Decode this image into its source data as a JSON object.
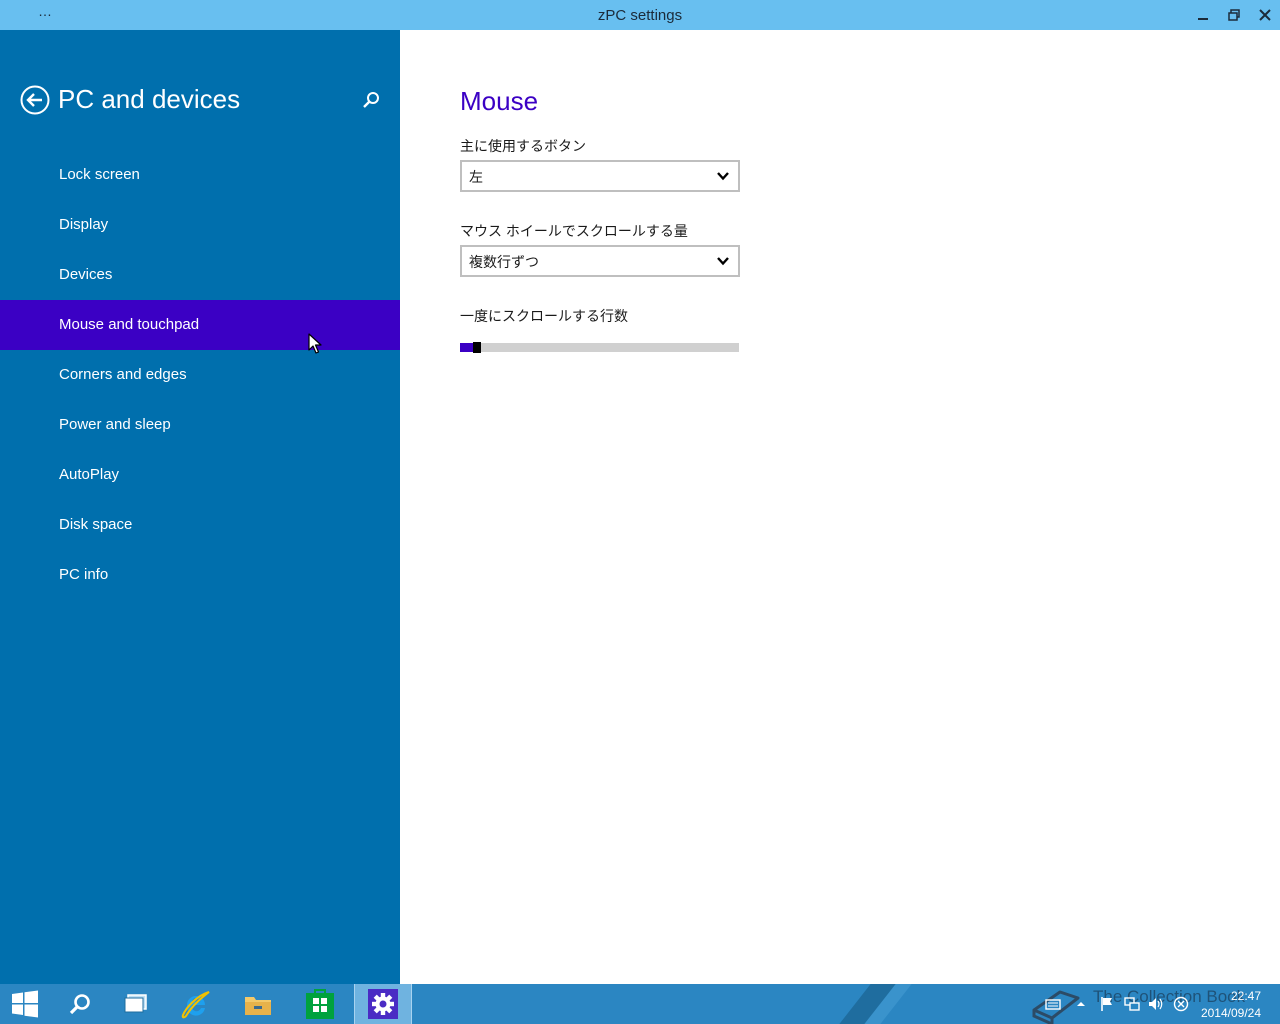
{
  "window": {
    "title": "zPC settings",
    "menu_glyph": "…",
    "controls": [
      "minimize",
      "restore",
      "close"
    ]
  },
  "sidebar": {
    "header_title": "PC and devices",
    "items": [
      {
        "label": "Lock screen",
        "active": false
      },
      {
        "label": "Display",
        "active": false
      },
      {
        "label": "Devices",
        "active": false
      },
      {
        "label": "Mouse and touchpad",
        "active": true
      },
      {
        "label": "Corners and edges",
        "active": false
      },
      {
        "label": "Power and sleep",
        "active": false
      },
      {
        "label": "AutoPlay",
        "active": false
      },
      {
        "label": "Disk space",
        "active": false
      },
      {
        "label": "PC info",
        "active": false
      }
    ]
  },
  "content": {
    "title": "Mouse",
    "primary_button": {
      "label": "主に使用するボタン",
      "value": "左"
    },
    "wheel_scroll": {
      "label": "マウス ホイールでスクロールする量",
      "value": "複数行ずつ"
    },
    "lines_per_scroll": {
      "label": "一度にスクロールする行数",
      "value_fraction": 0.04
    }
  },
  "taskbar": {
    "apps": [
      "start",
      "search",
      "task-view",
      "internet-explorer",
      "file-explorer",
      "store",
      "pc-settings"
    ],
    "active_app": "pc-settings",
    "watermark": "The Collection Book",
    "time": "22:47",
    "date": "2014/09/24"
  },
  "colors": {
    "titlebar": "#68bff0",
    "sidebar": "#006fad",
    "accent": "#3b00c4",
    "taskbar": "#2b86c2"
  }
}
